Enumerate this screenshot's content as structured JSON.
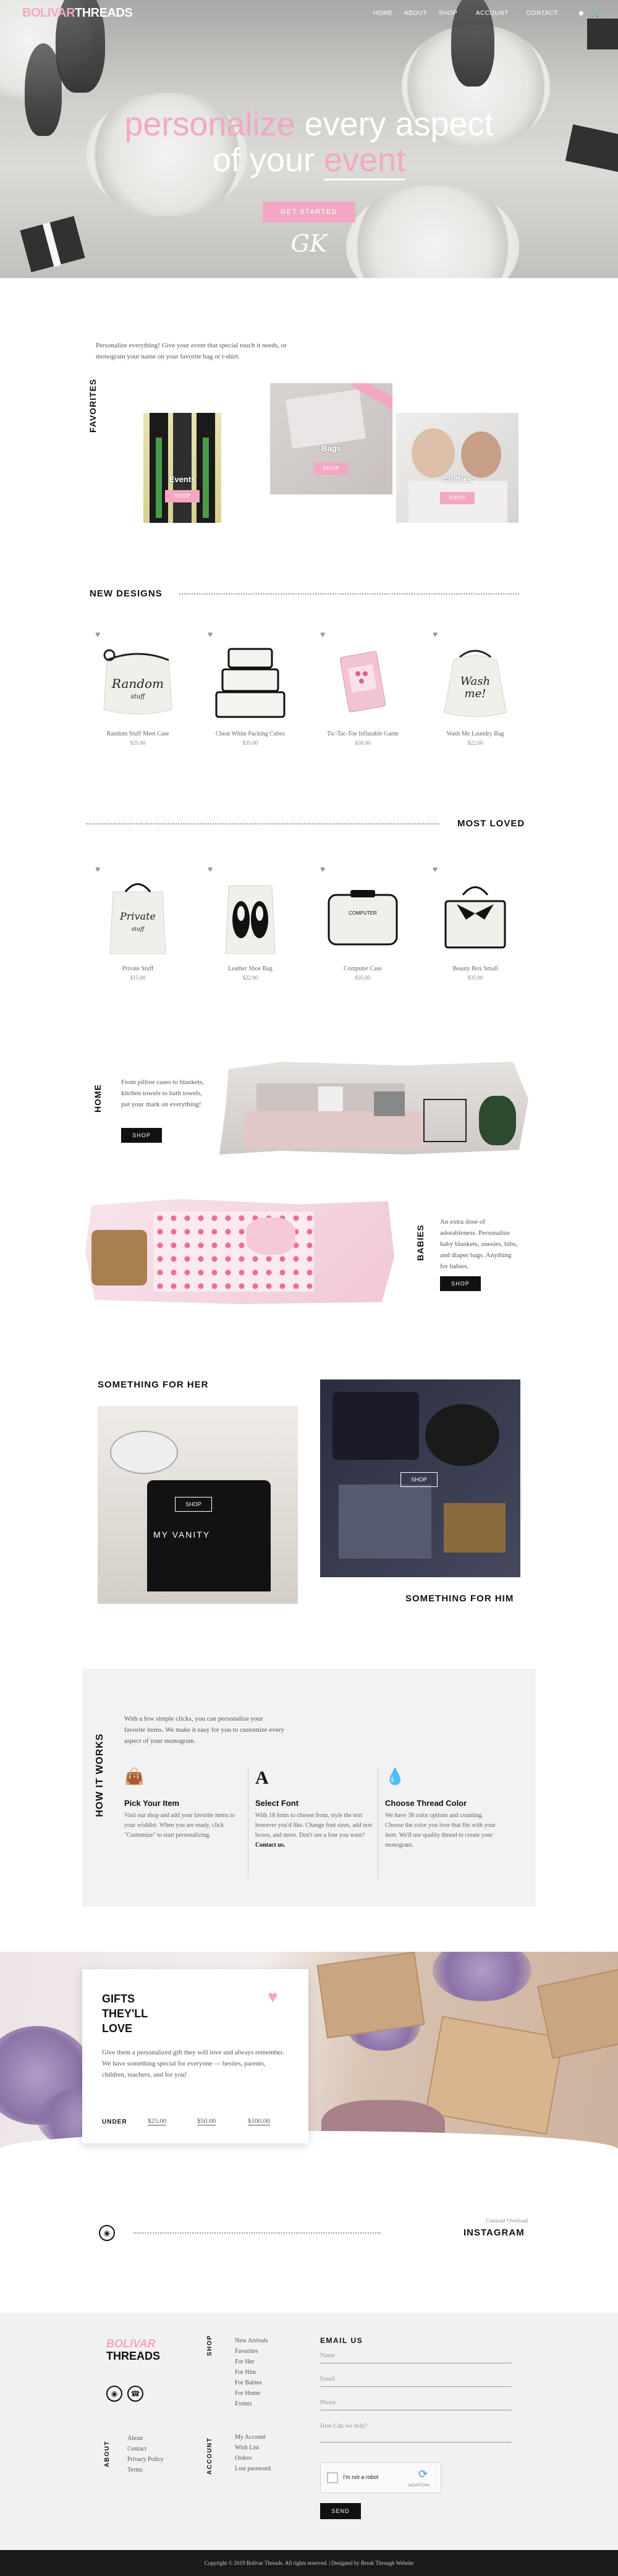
{
  "header": {
    "logo_main": "BOLIVAR",
    "logo_accent": "THREADS",
    "nav": [
      "HOME",
      "ABOUT",
      "SHOP",
      "ACCOUNT",
      "CONTACT"
    ]
  },
  "hero": {
    "line1_accent": "personalize",
    "line1_rest": " every aspect",
    "line2_start": "of your ",
    "line2_accent": "event",
    "cta": "GET STARTED",
    "monogram": "GK"
  },
  "favorites": {
    "heading": "FAVORITES",
    "intro": "Personalize everything! Give your event that special touch it needs, or monogram your name on your favorite bag or t-shirt.",
    "cards": [
      {
        "label": "Events",
        "button": "SHOP"
      },
      {
        "label": "Bags",
        "button": "SHOP"
      },
      {
        "label": "Clothes",
        "button": "SHOP"
      }
    ]
  },
  "new_designs": {
    "heading": "NEW DESIGNS",
    "products": [
      {
        "name": "Random Stuff Meet Case",
        "price": "$25.00"
      },
      {
        "name": "Cheat White Packing Cubes",
        "price": "$35.00"
      },
      {
        "name": "Tic-Tac-Toe Inflatable Game",
        "price": "$38.00"
      },
      {
        "name": "Wash Me Laundry Bag",
        "price": "$22.00"
      }
    ]
  },
  "most_loved": {
    "heading": "MOST LOVED",
    "products": [
      {
        "name": "Private Stuff",
        "price": "$15.00"
      },
      {
        "name": "Leather Shoe Bag",
        "price": "$22.00"
      },
      {
        "name": "Computer Case",
        "price": "$35.00"
      },
      {
        "name": "Beauty Box Small",
        "price": "$35.00"
      }
    ]
  },
  "home": {
    "heading": "HOME",
    "text": "From pillow cases to blankets, kitchen towels to bath towels, put your mark on everything!",
    "button": "SHOP"
  },
  "babies": {
    "heading": "BABIES",
    "text": "An extra dose of adorableness. Personalize baby blankets, onesies, bibs, and diaper bags. Anything for babies.",
    "button": "SHOP"
  },
  "her_him": {
    "her_heading": "SOMETHING FOR HER",
    "him_heading": "SOMETHING FOR HIM",
    "her_button": "SHOP",
    "him_button": "SHOP",
    "bag_text": "MY VANITY"
  },
  "how": {
    "heading": "HOW IT WORKS",
    "intro": "With a few simple clicks, you can personalize your favorite items. We make it easy for you to customize every aspect of your monogram.",
    "steps": [
      {
        "title": "Pick Your Item",
        "text": "Visit our shop and add your favorite items to your wishlist. When you are ready, click \"Customize\" to start personalizing."
      },
      {
        "title": "Select Font",
        "text": "With 18 fonts to choose from, style the text however you'd like. Change font sizes, add text boxes, and more. Don't see a font you want?",
        "link": "Contact us."
      },
      {
        "title": "Choose Thread Color",
        "text": "We have 38 color options and counting. Choose the color you love that fits with your item. We'll use quality thread to create your monogram."
      }
    ]
  },
  "gifts": {
    "title_l1": "GIFTS",
    "title_l2": "THEY'LL",
    "title_l3": "LOVE",
    "text": "Give them a personalized gift they will love and always remember. We have something special for everyone — besties, parents, children, teachers, and for you!",
    "under": "UNDER",
    "prices": [
      "$25.00",
      "$50.00",
      "$100.00"
    ]
  },
  "instagram": {
    "small": "Constant Overload",
    "heading": "INSTAGRAM"
  },
  "footer": {
    "logo_main": "BOLIVAR",
    "logo_accent": "THREADS",
    "shop_heading": "SHOP",
    "shop_links": [
      "New Arrivals",
      "Favorites",
      "For Her",
      "For Him",
      "For Babies",
      "For Home",
      "Events"
    ],
    "about_heading": "ABOUT",
    "about_links": [
      "About",
      "Contact",
      "Privacy Policy",
      "Terms"
    ],
    "account_heading": "ACCOUNT",
    "account_links": [
      "My Account",
      "Wish List",
      "Orders",
      "Lost password"
    ],
    "email_heading": "EMAIL US",
    "fields": [
      "Name",
      "Email",
      "Phone",
      "How Can we help?"
    ],
    "captcha": "I'm not a robot",
    "captcha_brand": "reCAPTCHA",
    "send": "SEND"
  },
  "copyright": "Copyright © 2019 Bolivar Threads. All rights reserved. | Designed by Break Through Website",
  "colors": {
    "accent_pink": "#f2a8c4",
    "black": "#111111",
    "light_gray": "#f2f2f2"
  }
}
